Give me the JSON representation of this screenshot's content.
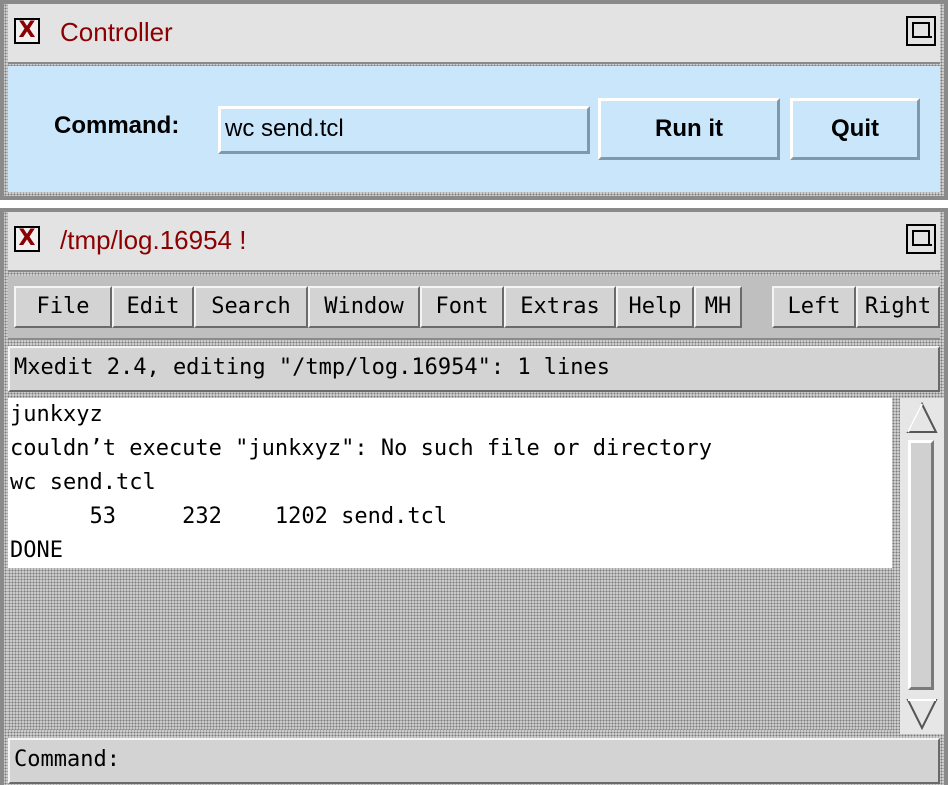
{
  "controller": {
    "title": "Controller",
    "command_label": "Command:",
    "command_value": "wc send.tcl",
    "run_label": "Run it",
    "quit_label": "Quit",
    "bg_color": "#c9e6fb"
  },
  "editor": {
    "title": "/tmp/log.16954 !",
    "menu": [
      "File",
      "Edit",
      "Search",
      "Window",
      "Font",
      "Extras",
      "Help",
      "MH",
      "Left",
      "Right"
    ],
    "status": "Mxedit 2.4, editing \"/tmp/log.16954\": 1 lines",
    "lines": [
      "junkxyz",
      "couldn’t execute \"junkxyz\": No such file or directory",
      "wc send.tcl",
      "      53     232    1202 send.tcl",
      "DONE"
    ],
    "command_prompt": "Command:"
  },
  "icons": {
    "window_menu": "x-logo-icon",
    "maximize": "maximize-icon",
    "scroll_up": "scroll-up-arrow-icon",
    "scroll_down": "scroll-down-arrow-icon"
  },
  "colors": {
    "title_text": "#8b0000",
    "titlebar_bg": "#e3e3e3",
    "menubar_bg": "#bfbfbf"
  }
}
